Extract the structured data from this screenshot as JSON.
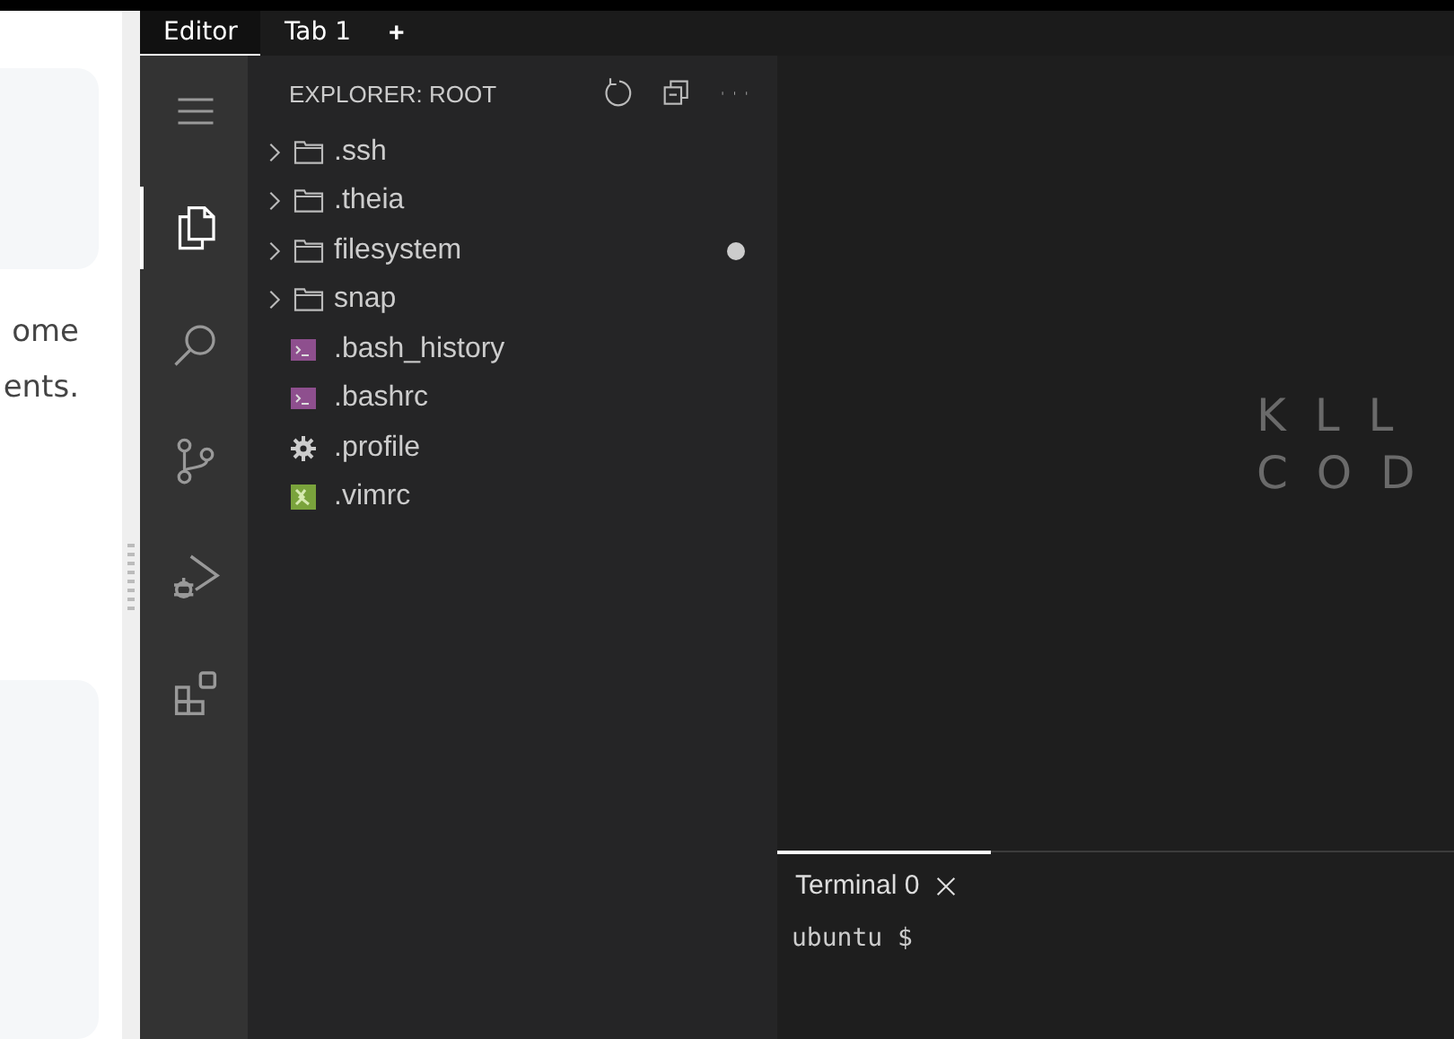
{
  "page": {
    "text_lines": [
      "ome",
      "ents."
    ]
  },
  "tabs": [
    {
      "label": "Editor",
      "selected": true
    },
    {
      "label": "Tab 1",
      "selected": false
    }
  ],
  "new_tab": "+",
  "activity_bar": [
    {
      "kind": "menu",
      "selected": false
    },
    {
      "kind": "explorer",
      "selected": true
    },
    {
      "kind": "search",
      "selected": false
    },
    {
      "kind": "source-control",
      "selected": false
    },
    {
      "kind": "debug",
      "selected": false
    },
    {
      "kind": "extensions",
      "selected": false
    }
  ],
  "explorer": {
    "title": "EXPLORER: ROOT",
    "items": [
      {
        "kind": "folder",
        "name": ".ssh",
        "modified": false
      },
      {
        "kind": "folder",
        "name": ".theia",
        "modified": false
      },
      {
        "kind": "folder",
        "name": "filesystem",
        "modified": true
      },
      {
        "kind": "folder",
        "name": "snap",
        "modified": false
      },
      {
        "kind": "shell",
        "name": ".bash_history",
        "modified": false
      },
      {
        "kind": "shell",
        "name": ".bashrc",
        "modified": false
      },
      {
        "kind": "settings",
        "name": ".profile",
        "modified": false
      },
      {
        "kind": "vim",
        "name": ".vimrc",
        "modified": false
      }
    ]
  },
  "editor": {
    "logo_lines": [
      "K L L",
      "C O D"
    ]
  },
  "terminal": {
    "tabs": [
      {
        "label": "Terminal 0",
        "selected": true
      }
    ],
    "prompt": "ubuntu $"
  }
}
